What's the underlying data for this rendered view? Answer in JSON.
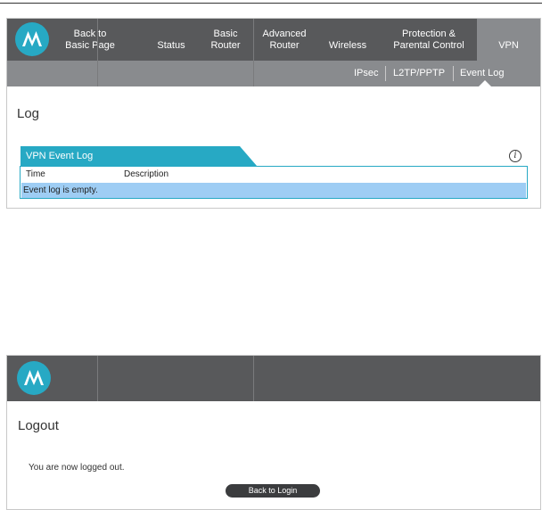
{
  "brand": {
    "accent_color": "#27a9c4",
    "nav_bg": "#58595b",
    "subnav_bg": "#898b8e",
    "logo_icon": "motorola-batwing-icon"
  },
  "nav": {
    "items": [
      {
        "id": "back",
        "line1": "Back to",
        "line2": "Basic Page"
      },
      {
        "id": "status",
        "line1": "",
        "line2": "Status"
      },
      {
        "id": "basic-router",
        "line1": "Basic",
        "line2": "Router"
      },
      {
        "id": "advanced-router",
        "line1": "Advanced",
        "line2": "Router"
      },
      {
        "id": "wireless",
        "line1": "",
        "line2": "Wireless"
      },
      {
        "id": "protection",
        "line1": "Protection &",
        "line2": "Parental Control"
      },
      {
        "id": "vpn",
        "line1": "",
        "line2": "VPN",
        "active": true
      }
    ]
  },
  "subnav": {
    "items": [
      "IPsec",
      "L2TP/PPTP",
      "Event Log"
    ],
    "active": "Event Log"
  },
  "log_page": {
    "title": "Log",
    "tab_label": "VPN Event Log",
    "info_icon": "i",
    "columns": [
      "Time",
      "Description"
    ],
    "empty_message": "Event log is empty."
  },
  "logout_page": {
    "title": "Logout",
    "message": "You are now logged out.",
    "button_label": "Back to Login"
  }
}
